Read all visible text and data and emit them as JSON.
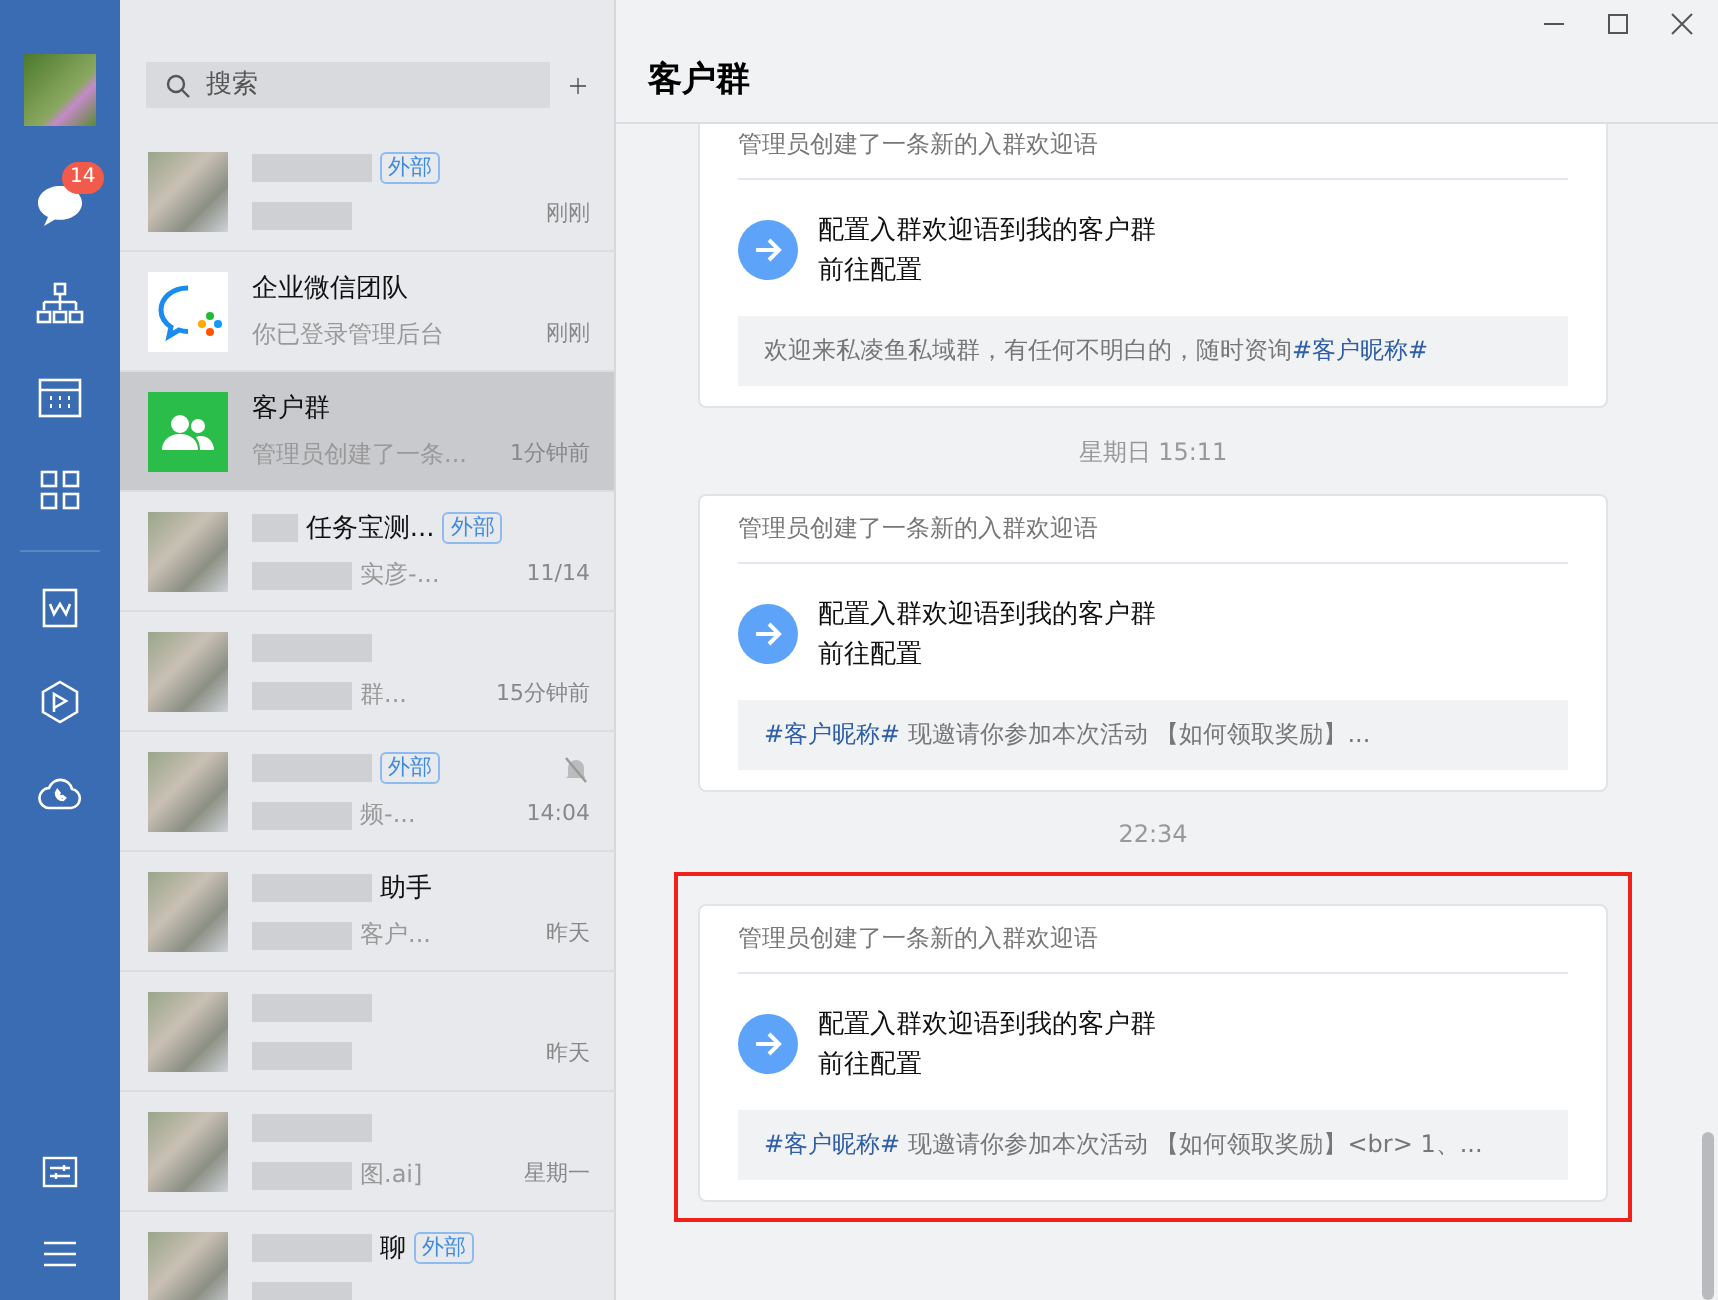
{
  "sidebar": {
    "badge": "14"
  },
  "search": {
    "placeholder": "搜索"
  },
  "conversations": [
    {
      "kind": "blurred",
      "tag": "外部",
      "time": "刚刚",
      "selected": false,
      "muted": false
    },
    {
      "kind": "logo",
      "name": "企业微信团队",
      "preview": "你已登录管理后台",
      "time": "刚刚",
      "selected": false,
      "muted": false
    },
    {
      "kind": "group",
      "name": "客户群",
      "preview": "管理员创建了一条...",
      "time": "1分钟前",
      "selected": true,
      "muted": false
    },
    {
      "kind": "blurred",
      "name": "任务宝测...",
      "tag": "外部",
      "preview": "实彦-...",
      "time": "11/14",
      "selected": false,
      "muted": false
    },
    {
      "kind": "blurred",
      "preview": "群...",
      "time": "15分钟前",
      "selected": false,
      "muted": false
    },
    {
      "kind": "blurred",
      "tag": "外部",
      "preview": "频-...",
      "time": "14:04",
      "selected": false,
      "muted": true
    },
    {
      "kind": "blurred",
      "name": "助手",
      "preview": "客户...",
      "time": "昨天",
      "selected": false,
      "muted": false
    },
    {
      "kind": "blurred",
      "time": "昨天",
      "selected": false,
      "muted": false
    },
    {
      "kind": "blurred",
      "preview": "图.ai]",
      "time": "星期一",
      "selected": false,
      "muted": false
    },
    {
      "kind": "blurred",
      "name": "聊",
      "tag": "外部",
      "selected": false,
      "muted": false
    }
  ],
  "chat": {
    "title": "客户群",
    "messages": [
      {
        "kind": "card",
        "highlighted": false,
        "header": "管理员创建了一条新的入群欢迎语",
        "action_title": "配置入群欢迎语到我的客户群",
        "action_link": "前往配置",
        "content": [
          {
            "text": "欢迎来私凌鱼私域群，有任何不明白的，随时资询",
            "variable": false
          },
          {
            "text": "#客户昵称#",
            "variable": true
          }
        ]
      },
      {
        "kind": "time",
        "text": "星期日 15:11"
      },
      {
        "kind": "card",
        "highlighted": false,
        "header": "管理员创建了一条新的入群欢迎语",
        "action_title": "配置入群欢迎语到我的客户群",
        "action_link": "前往配置",
        "content": [
          {
            "text": "#客户昵称#",
            "variable": true
          },
          {
            "text": " 现邀请你参加本次活动 【如何领取奖励】...",
            "variable": false
          }
        ]
      },
      {
        "kind": "time",
        "text": "22:34"
      },
      {
        "kind": "card",
        "highlighted": true,
        "header": "管理员创建了一条新的入群欢迎语",
        "action_title": "配置入群欢迎语到我的客户群",
        "action_link": "前往配置",
        "content": [
          {
            "text": "#客户昵称#",
            "variable": true
          },
          {
            "text": " 现邀请你参加本次活动 【如何领取奖励】<br> 1、...",
            "variable": false
          }
        ]
      }
    ]
  }
}
